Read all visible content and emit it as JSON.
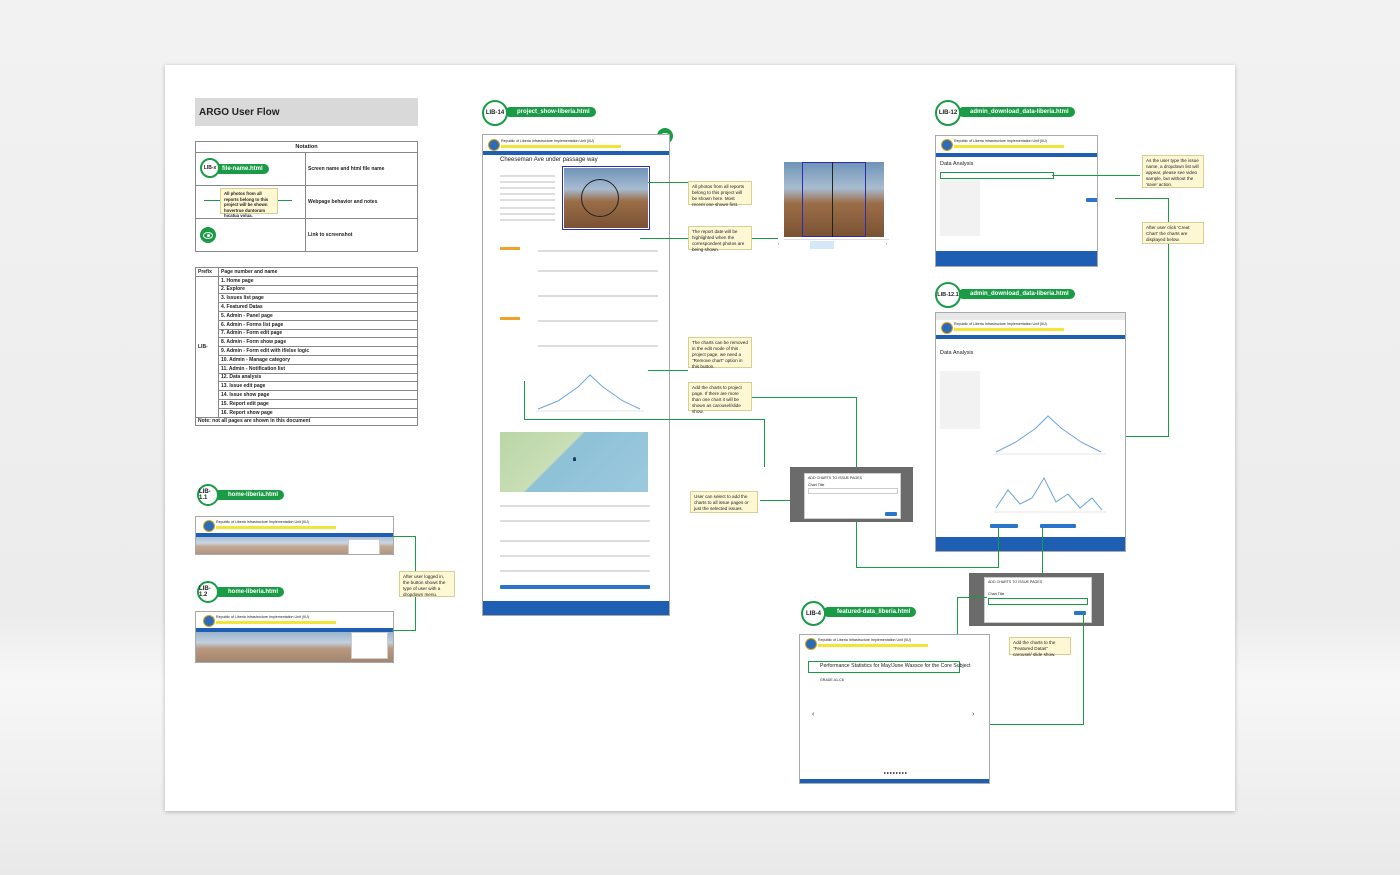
{
  "page_title": "ARGO User Flow",
  "notation": {
    "header": "Notation",
    "rows": [
      {
        "sample_code": "LIB-x",
        "sample_pill": "file-name.html",
        "description": "Screen name and html file name"
      },
      {
        "sample_note": "All photos from all reports belong to this project will be shown hovertrue duntorum hicatua volua.",
        "description": "Webpage behavior and notes"
      },
      {
        "description": "Link to screenshot"
      }
    ]
  },
  "pages_table": {
    "col_prefix": "Prefix",
    "col_page": "Page number and name",
    "prefix": "LIB-",
    "pages": [
      "1.  Home page",
      "2.  Explore",
      "3.  Issues list page",
      "4.  Featured Datas",
      "5.  Admin - Panel page",
      "6.  Admin - Forms list page",
      "7.  Admin - Form edit page",
      "8.  Admin - Form show page",
      "9.  Admin - Form edit with if/else logic",
      "10.  Admin - Manage category",
      "11.  Admin - Notification list",
      "12.  Data analysis",
      "13.  Issue edit page",
      "14.  Issue show page",
      "15.  Report edit page",
      "16.  Report show page"
    ],
    "footnote": "Note: not all pages are shown in this document"
  },
  "screens": [
    {
      "code": "LIB-14",
      "file": "project_show-liberia.html"
    },
    {
      "code": "LIB-12",
      "file": "admin_download_data-liberia.html"
    },
    {
      "code": "LIB-12.1",
      "file": "admin_download_data-liberia.html"
    },
    {
      "code": "LIB-1.1",
      "file": "home-liberia.html"
    },
    {
      "code": "LIB-1.2",
      "file": "home-liberia.html"
    },
    {
      "code": "LIB-4",
      "file": "featured-data_liberia.html"
    }
  ],
  "site": {
    "org_name": "Republic of Liberia Infrastructure Implementation Unit (IIU)",
    "project_title": "Cheeseman Ave under passage way",
    "data_analysis": "Data Analysis",
    "featured_heading": "Performance Statistics for May/June Wassce for the Core Subject",
    "featured_sub": "GRADE A1-C6",
    "dialog_title": "ADD CHARTS TO ISSUE PAGES",
    "chart_title_label": "Chart Title",
    "prev_arrow": "‹",
    "next_arrow": "›"
  },
  "notes": [
    "All photos from all reports belong to this project will be shown here. Most recent one shown first.",
    "The report date will be highlighted when the correspondent photos are being shown.",
    "The charts can be removed in the edit mode of this project page, we need a \"Remove chart\" option in this button.",
    "Add the charts to project page. If there are more than one chart it will be shown as carousel/slide show.",
    "User can select to add the charts to all issue pages or just the selected issues.",
    "As the user type the issue name, a dropdown list will appear, please see video sample, but without the 'save' action.",
    "After user click 'Creat Chart' the charts are displayed below.",
    "After user logged in, the button shows the type of user with a dropdown menu.",
    "Add the charts to the \"Featured Datas\" carousel/ slide show."
  ],
  "colors": {
    "green": "#1a9b45",
    "blue": "#1e5fb3",
    "note_bg": "#fdf7d4"
  }
}
